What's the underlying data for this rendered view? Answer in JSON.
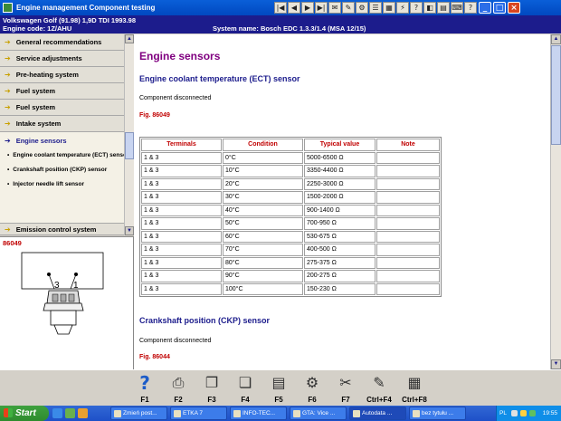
{
  "window": {
    "title": "Engine management Component testing"
  },
  "vehicle": {
    "line1": "Volkswagen    Golf (91.98) 1,9D TDI 1993.98",
    "line2": "Engine code: 1Z/AHU",
    "system": "System name: Bosch EDC 1.3.3/1.4 (MSA 12/15)"
  },
  "toolbar": {
    "buttons": [
      "|◀",
      "◀",
      "▶",
      "▶|",
      "✉",
      "✎",
      "⚙",
      "☰",
      "▦",
      "⚡",
      "?",
      "◧",
      "▤",
      "⌨",
      "?"
    ],
    "controls": [
      "_",
      "□",
      "×"
    ]
  },
  "sidebar": {
    "items": [
      "General recommendations",
      "Service adjustments",
      "Pre-heating system",
      "Fuel system",
      "Fuel system",
      "Intake system"
    ],
    "active": "Engine sensors",
    "subitems": [
      "Engine coolant temperature (ECT) sensor",
      "Crankshaft position (CKP) sensor",
      "Injector needle lift sensor"
    ],
    "partial": "Emission control system"
  },
  "thumbnail": {
    "fig": "86049",
    "pins": [
      "3",
      "1"
    ]
  },
  "main": {
    "heading": "Engine sensors",
    "section1": {
      "title": "Engine coolant temperature (ECT) sensor",
      "status": "Component disconnected",
      "fig": "Fig. 86049"
    },
    "table": {
      "headers": [
        "Terminals",
        "Condition",
        "Typical value",
        "Note"
      ],
      "rows": [
        [
          "1 & 3",
          "0°C",
          "5000-6500 Ω",
          ""
        ],
        [
          "1 & 3",
          "10°C",
          "3350-4400 Ω",
          ""
        ],
        [
          "1 & 3",
          "20°C",
          "2250-3000 Ω",
          ""
        ],
        [
          "1 & 3",
          "30°C",
          "1500-2000 Ω",
          ""
        ],
        [
          "1 & 3",
          "40°C",
          "900-1400 Ω",
          ""
        ],
        [
          "1 & 3",
          "50°C",
          "700-950 Ω",
          ""
        ],
        [
          "1 & 3",
          "60°C",
          "530-675 Ω",
          ""
        ],
        [
          "1 & 3",
          "70°C",
          "400-500 Ω",
          ""
        ],
        [
          "1 & 3",
          "80°C",
          "275-375 Ω",
          ""
        ],
        [
          "1 & 3",
          "90°C",
          "200-275 Ω",
          ""
        ],
        [
          "1 & 3",
          "100°C",
          "150-230 Ω",
          ""
        ]
      ]
    },
    "section2": {
      "title": "Crankshaft position (CKP) sensor",
      "status": "Component disconnected",
      "fig": "Fig. 86044"
    }
  },
  "fkeys": [
    {
      "label": "F1",
      "icon": "help-icon",
      "glyph": "?"
    },
    {
      "label": "F2",
      "icon": "print-icon",
      "glyph": "⎙"
    },
    {
      "label": "F3",
      "icon": "copy-icon",
      "glyph": "❐"
    },
    {
      "label": "F4",
      "icon": "paste-icon",
      "glyph": "❏"
    },
    {
      "label": "F5",
      "icon": "document-icon",
      "glyph": "▤"
    },
    {
      "label": "F6",
      "icon": "tool-icon",
      "glyph": "⚙"
    },
    {
      "label": "F7",
      "icon": "tools-icon",
      "glyph": "✂"
    },
    {
      "label": "Ctrl+F4",
      "icon": "note-icon",
      "glyph": "✎"
    },
    {
      "label": "Ctrl+F8",
      "icon": "table-icon",
      "glyph": "▦"
    }
  ],
  "taskbar": {
    "start": "Start",
    "tasks": [
      "Zmień post...",
      "ETKA 7",
      "INFO-TEC...",
      "GTA: Vice ...",
      "Autodata ...",
      "bez tytułu ..."
    ],
    "lang": "PL",
    "clock": "19:55"
  },
  "colors": {
    "accent": "#1c1c8c",
    "heading": "#800080",
    "figref": "#c00000"
  }
}
